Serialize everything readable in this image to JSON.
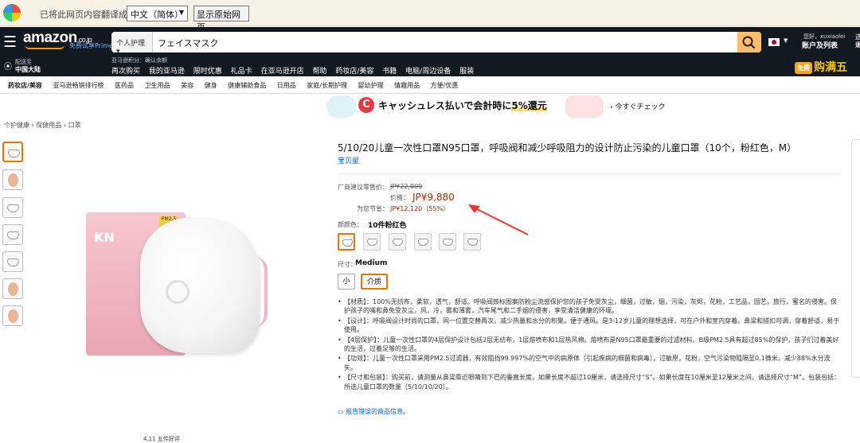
{
  "translate_bar": {
    "message": "已将此网页内容翻译成",
    "language": "中文（简体）",
    "show_original": "显示原始网页"
  },
  "header": {
    "logo": "amazon",
    "logo_domain": ".co.jp",
    "prime_text": "免费试享Prime",
    "search_category": "个人护理",
    "search_query": "フェイスマスク",
    "greeting": "您好，xuxiaolei",
    "account": "账户及列表",
    "deliver_line1": "配送至",
    "deliver_line2": "中国大陆",
    "points": "亚马逊积分：确认余额",
    "nav_items": [
      "再次购买",
      "我的亚马逊",
      "限时优惠",
      "礼品卡",
      "在亚马逊开店",
      "帮助",
      "药妆店/美容",
      "书籍",
      "电脑/周边设备",
      "服装"
    ],
    "promo_badge": "免费",
    "promo_text": "购满五",
    "cut_right_1": "选",
    "cut_right_2": "退"
  },
  "subnav": [
    "药妆店/美容",
    "亚马逊畅销排行榜",
    "医药品",
    "卫生用品",
    "美容",
    "健身",
    "健康辅助食品",
    "日用品",
    "家庭/长期护理",
    "婴幼护理",
    "情趣用品",
    "方便/优惠"
  ],
  "banner": {
    "text_before": "キャッシュレス払いで会計時に",
    "text_highlight": "5%還元",
    "link": "› 今すぐチェック"
  },
  "breadcrumb": "个护健康 › 保健用品 › 口罩",
  "product": {
    "title": "5/10/20儿童一次性口罩N95口罩，呼吸阀和减少呼吸阻力的设计防止污染的儿童口罩（10个，粉红色，M）",
    "brand": "宝贝星",
    "list_price_label": "厂商建议零售价：",
    "list_price": "JP¥22,000",
    "price_label": "价格：",
    "price": "JP¥9,880",
    "savings_label": "为您节省：",
    "savings": "JP¥12,120（55%）",
    "color_label": "颜颜色：",
    "color_value": "10件粉红色",
    "size_label": "尺寸：",
    "size_value": "Medium",
    "sizes": [
      "小",
      "介质"
    ],
    "bullets": [
      "【材质】：100%无纺布，柔软，透气，舒适。呼吸阀鼓标图案防粉尘流感保护您的孩子免受灰尘，细菌，过敏，烟，污染，灰烬，花粉，工艺品，园艺，旅行，蜜名的侵害。保护孩子的嘴和鼻免受灰尘，风，冷，雾和薄雾，汽车尾气和二手烟的侵害，享受清洁健康的环境。",
      "【设计】：呼吸阀设计时尚的口罩，同一位置交替两次，减少热量和水分的积聚。便于通风。是3-12岁儿童的理想选择，可在户外和室内穿着。鼻梁和搭扣可调，穿着舒适，易于使用。",
      "【4层保护】：儿童一次性口罩的4层保护设计包括2层无纺布，1层熔喷布和1层热风棉。熔喷布是N95口罩最重要的过滤材料。B级PM2.5具有超过85%的保护，孩子们过着美好的生活，过着足够的生活。",
      "【功效】：儿童一次性口罩采用PM2.5过滤器，有效阻挡99.997%的空气中的病原体（引起疾病的细菌和病毒），过敏原，花粉，空气污染物阻隔至0.1微米，减少88%水分流失。",
      "【尺寸和包装】：购买前，请测量从鼻梁靠近眼睛到下巴的垂直长度。如果长度不超过10厘米，请选择尺寸“S”。如果长度在10厘米至12厘米之间，请选择尺寸“M”。包装包括：所选儿童口罩的数量（5/10/10/20）。"
    ],
    "report": "报告错误的商品信息。",
    "image_pack_text": "KN",
    "image_pack_badge": "PM2.5"
  },
  "footer_text": "4.11 五件好评"
}
